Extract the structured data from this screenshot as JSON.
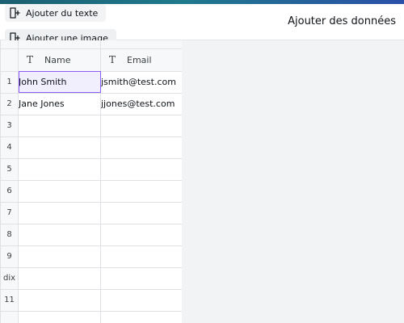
{
  "toolbar": {
    "add_text_label": "Ajouter du texte",
    "add_image_label": "Ajouter une image"
  },
  "panel": {
    "title": "Ajouter des données"
  },
  "table": {
    "columns": [
      {
        "label": "Name",
        "type_icon": "text-type-icon"
      },
      {
        "label": "Email",
        "type_icon": "text-type-icon"
      }
    ],
    "rows": [
      {
        "num": "1",
        "cells": [
          "John Smith",
          "jsmith@test.com"
        ]
      },
      {
        "num": "2",
        "cells": [
          "Jane Jones",
          "jjones@test.com"
        ]
      },
      {
        "num": "3",
        "cells": [
          "",
          ""
        ]
      },
      {
        "num": "4",
        "cells": [
          "",
          ""
        ]
      },
      {
        "num": "5",
        "cells": [
          "",
          ""
        ]
      },
      {
        "num": "6",
        "cells": [
          "",
          ""
        ]
      },
      {
        "num": "7",
        "cells": [
          "",
          ""
        ]
      },
      {
        "num": "8",
        "cells": [
          "",
          ""
        ]
      },
      {
        "num": "9",
        "cells": [
          "",
          ""
        ]
      },
      {
        "num": "dix",
        "cells": [
          "",
          ""
        ]
      },
      {
        "num": "11",
        "cells": [
          "",
          ""
        ]
      },
      {
        "num": "",
        "cells": [
          "",
          ""
        ]
      }
    ]
  },
  "colors": {
    "accent": "#8b5cf6",
    "selected_bg": "#f1eefe"
  }
}
